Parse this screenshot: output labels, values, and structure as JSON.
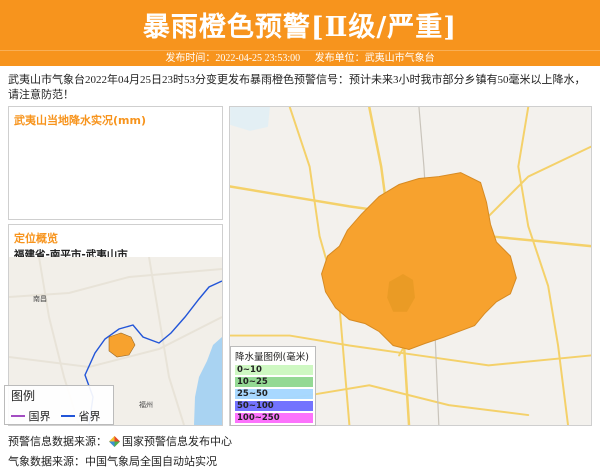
{
  "banner": {
    "title": "暴雨橙色预警[Ⅱ级/严重]",
    "publish_time_label": "发布时间：2022-04-25 23:53:00",
    "publisher_label": "发布单位：武夷山市气象台"
  },
  "description": "武夷山市气象台2022年04月25日23时53分变更发布暴雨橙色预警信号：预计未来3小时我市部分乡镇有50毫米以上降水，请注意防范！",
  "rain_panel": {
    "title": "武夷山当地降水实况(mm)"
  },
  "location_panel": {
    "title": "定位概览",
    "path": "福建省-南平市-武夷山市",
    "city_labels": [
      "南昌",
      "福州"
    ]
  },
  "small_legend": {
    "title": "图例",
    "national_border": "国界",
    "provincial_border": "省界"
  },
  "rain_legend": {
    "title": "降水量图例(毫米)",
    "items": [
      {
        "label": "0~10",
        "color": "#a6f28f"
      },
      {
        "label": "10~25",
        "color": "#3dba3d"
      },
      {
        "label": "25~50",
        "color": "#61b8ff"
      },
      {
        "label": "50~100",
        "color": "#0000fe"
      },
      {
        "label": "100~250",
        "color": "#fa00fa"
      }
    ]
  },
  "footer": {
    "warning_source_label": "预警信息数据来源：",
    "warning_source": "国家预警信息发布中心",
    "weather_source_label": "气象数据来源：",
    "weather_source": "中国气象局全国自动站实况"
  },
  "colors": {
    "accent": "#f7941d",
    "warning_area": "#f7a22e"
  }
}
